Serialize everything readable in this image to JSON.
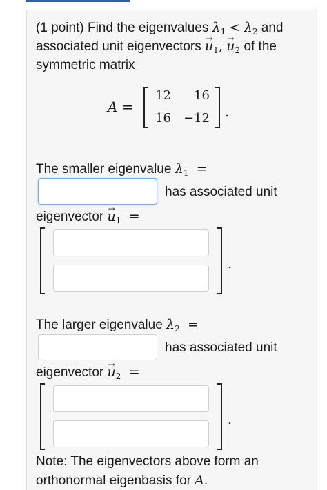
{
  "problem": {
    "line1_points": "(1 point) Find the eigenvalues",
    "line1_and": "and",
    "line2_text": "associated unit eigenvectors",
    "line2_end": "of the",
    "line3": "symmetric matrix",
    "matrix_lhs": "A =",
    "matrix": [
      [
        "12",
        "16"
      ],
      [
        "16",
        "−12"
      ]
    ],
    "matrix_period": "."
  },
  "part1": {
    "label": "The smaller eigenvalue",
    "eigen_symbol": "λ",
    "eigen_sub": "1",
    "equals": "=",
    "assoc": "has associated unit",
    "eigvec_label": "eigenvector",
    "vec_symbol": "u",
    "vec_sub": "1",
    "vec_equals": "=",
    "input_value": "",
    "vec_inputs": [
      "",
      ""
    ],
    "period": "."
  },
  "part2": {
    "label": "The larger eigenvalue",
    "eigen_symbol": "λ",
    "eigen_sub": "2",
    "equals": "=",
    "assoc": "has associated unit",
    "eigvec_label": "eigenvector",
    "vec_symbol": "u",
    "vec_sub": "2",
    "vec_equals": "=",
    "input_value": "",
    "vec_inputs": [
      "",
      ""
    ],
    "period": "."
  },
  "note": {
    "line1": "Note: The eigenvectors above form an",
    "line2": "orthonormal eigenbasis for",
    "symbol": "A",
    "end": "."
  },
  "symbols": {
    "lambda": "λ",
    "sub1": "1",
    "sub2": "2",
    "lt": "<",
    "u": "u",
    "comma": ","
  },
  "colors": {
    "panel_bg": "#f6f6f6",
    "accent": "#2f5fa8",
    "focus_border": "#7aa7e8"
  }
}
